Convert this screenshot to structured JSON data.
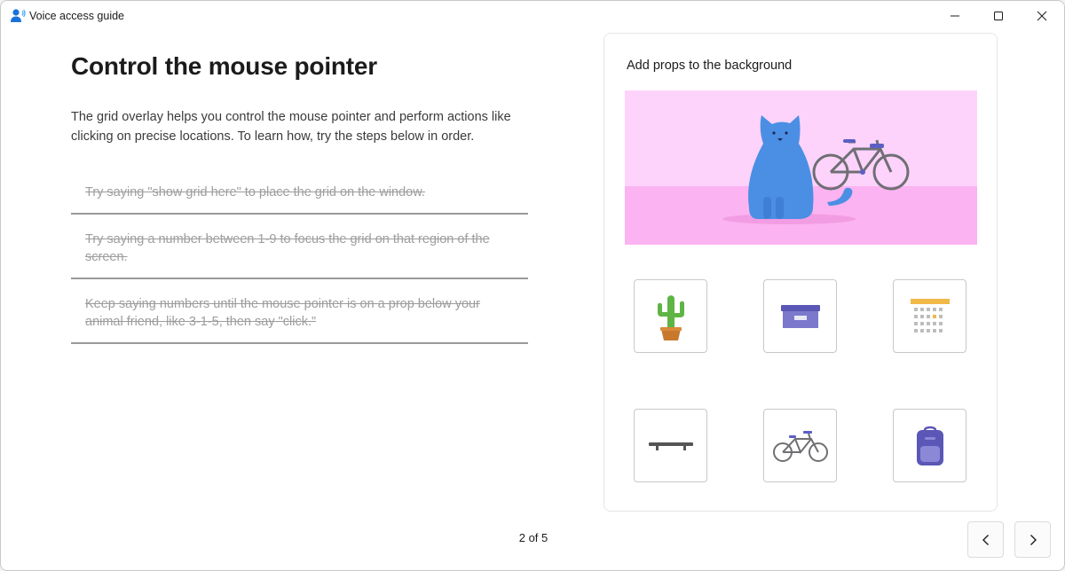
{
  "window": {
    "title": "Voice access guide",
    "controls": {
      "minimize": "minimize-icon",
      "maximize": "maximize-icon",
      "close": "close-icon"
    }
  },
  "main": {
    "heading": "Control the mouse pointer",
    "description": "The grid overlay helps you control the mouse pointer and perform actions like clicking on precise locations. To learn how, try the steps below in order.",
    "steps": [
      "Try saying \"show grid here\" to place the grid on the window.",
      "Try saying a number between 1-9 to focus the grid on that region of the screen.",
      "Keep saying numbers until the mouse pointer is on a prop below your animal friend, like 3-1-5, then say \"click.\""
    ]
  },
  "card": {
    "title": "Add props to the background",
    "scene": [
      "cat-illustration",
      "bicycle-illustration"
    ],
    "props": [
      "cactus-icon",
      "storage-box-icon",
      "calendar-icon",
      "shelf-icon",
      "bicycle-icon",
      "backpack-icon"
    ]
  },
  "pager": {
    "indicator": "2 of 5",
    "prev": "chevron-left-icon",
    "next": "chevron-right-icon"
  },
  "colors": {
    "scene_sky": "#fdd3fb",
    "scene_floor": "#fbb3f1",
    "cat_blue": "#4a8fe4",
    "prop_purple": "#7c78cc",
    "cactus_green": "#5fb544",
    "calendar_yellow": "#f0b94a"
  }
}
